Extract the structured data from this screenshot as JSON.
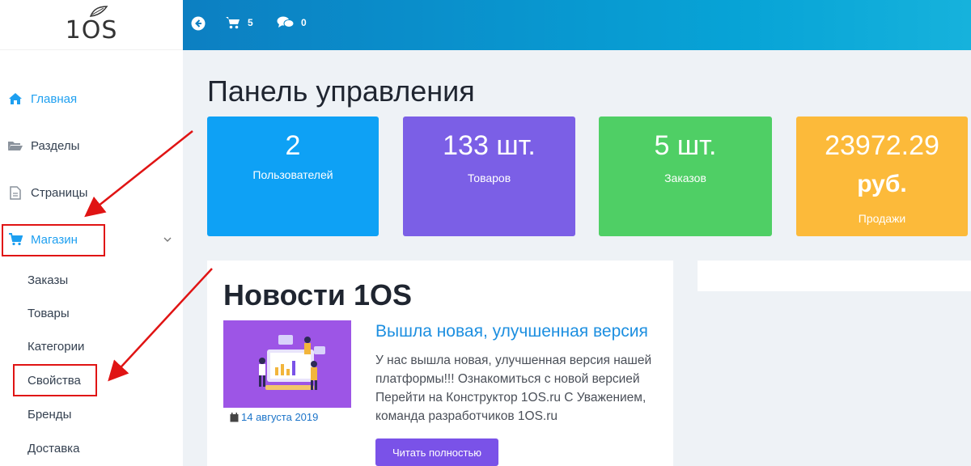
{
  "logo": {
    "text": "1OS"
  },
  "topbar": {
    "cart_count": "5",
    "messages_count": "0"
  },
  "sidebar": {
    "items": [
      {
        "label": "Главная"
      },
      {
        "label": "Разделы"
      },
      {
        "label": "Страницы"
      },
      {
        "label": "Магазин"
      }
    ],
    "subitems": [
      {
        "label": "Заказы"
      },
      {
        "label": "Товары"
      },
      {
        "label": "Категории"
      },
      {
        "label": "Свойства"
      },
      {
        "label": "Бренды"
      },
      {
        "label": "Доставка"
      }
    ]
  },
  "main": {
    "title": "Панель управления",
    "cards": [
      {
        "value": "2",
        "label": "Пользователей",
        "color": "#0ea1f5"
      },
      {
        "value": "133 шт.",
        "label": "Товаров",
        "color": "#7b5fe6"
      },
      {
        "value": "5 шт.",
        "label": "Заказов",
        "color": "#4fcf65"
      },
      {
        "value": "23972.29",
        "value2": "руб.",
        "label": "Продажи",
        "color": "#fcba3a"
      }
    ]
  },
  "news": {
    "title": "Новости 1OS",
    "headline": "Вышла новая, улучшенная версия",
    "body": "У нас вышла новая, улучшенная версия нашей платформы!!! Ознакомиться с новой версией Перейти на Конструктор 1OS.ru С Уважением, команда разработчиков 1OS.ru",
    "date": "14 августа 2019",
    "read_more": "Читать полностью"
  },
  "colors": {
    "accent": "#1d9ff0",
    "highlight": "#e01414",
    "button": "#7a52e8"
  }
}
